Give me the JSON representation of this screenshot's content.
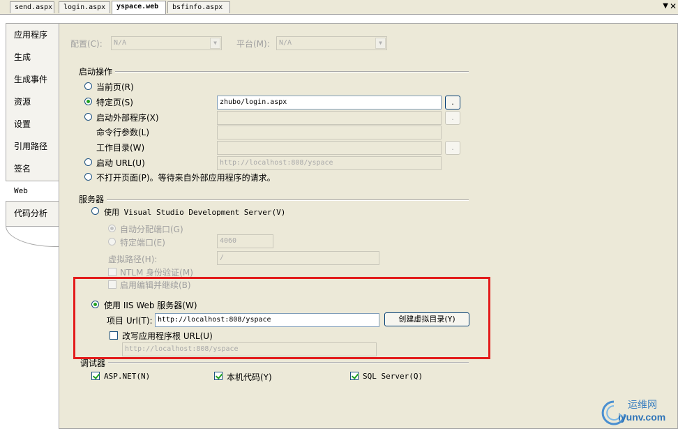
{
  "tabs": [
    {
      "label": "send.aspx"
    },
    {
      "label": "login.aspx"
    },
    {
      "label": "yspace.web"
    },
    {
      "label": "bsfinfo.aspx"
    }
  ],
  "nav": {
    "items": [
      {
        "label": "应用程序"
      },
      {
        "label": "生成"
      },
      {
        "label": "生成事件"
      },
      {
        "label": "资源"
      },
      {
        "label": "设置"
      },
      {
        "label": "引用路径"
      },
      {
        "label": "签名"
      },
      {
        "label": "Web"
      },
      {
        "label": "代码分析"
      }
    ]
  },
  "config": {
    "config_label": "配置(C):",
    "config_value": "N/A",
    "platform_label": "平台(M):",
    "platform_value": "N/A"
  },
  "start": {
    "group_label": "启动操作",
    "current_page": "当前页(R)",
    "specific_page": "特定页(S)",
    "specific_page_value": "zhubo/login.aspx",
    "browse_btn": ".",
    "external_program": "启动外部程序(X)",
    "cmd_args": "命令行参数(L)",
    "working_dir": "工作目录(W)",
    "start_url": "启动 URL(U)",
    "start_url_value": "http://localhost:808/yspace",
    "dont_open": "不打开页面(P)。等待来自外部应用程序的请求。"
  },
  "server": {
    "group_label": "服务器",
    "use_vs_server": "使用 Visual Studio Development Server(V)",
    "auto_port": "自动分配端口(G)",
    "specific_port": "特定端口(E)",
    "specific_port_value": "4060",
    "virtual_path": "虚拟路径(H):",
    "virtual_path_value": "/",
    "ntlm": "NTLM 身份验证(M)",
    "edit_continue": "启用编辑并继续(B)",
    "use_iis": "使用 IIS Web 服务器(W)",
    "project_url_label": "项目 Url(T):",
    "project_url_value": "http://localhost:808/yspace",
    "create_vdir_btn": "创建虚拟目录(Y)",
    "override_root": "改写应用程序根 URL(U)",
    "override_root_value": "http://localhost:808/yspace"
  },
  "debugger": {
    "group_label": "调试器",
    "aspnet": "ASP.NET(N)",
    "native": "本机代码(Y)",
    "sql": "SQL Server(Q)"
  },
  "watermark": {
    "cn": "运维网",
    "url": "iyunv.com"
  }
}
